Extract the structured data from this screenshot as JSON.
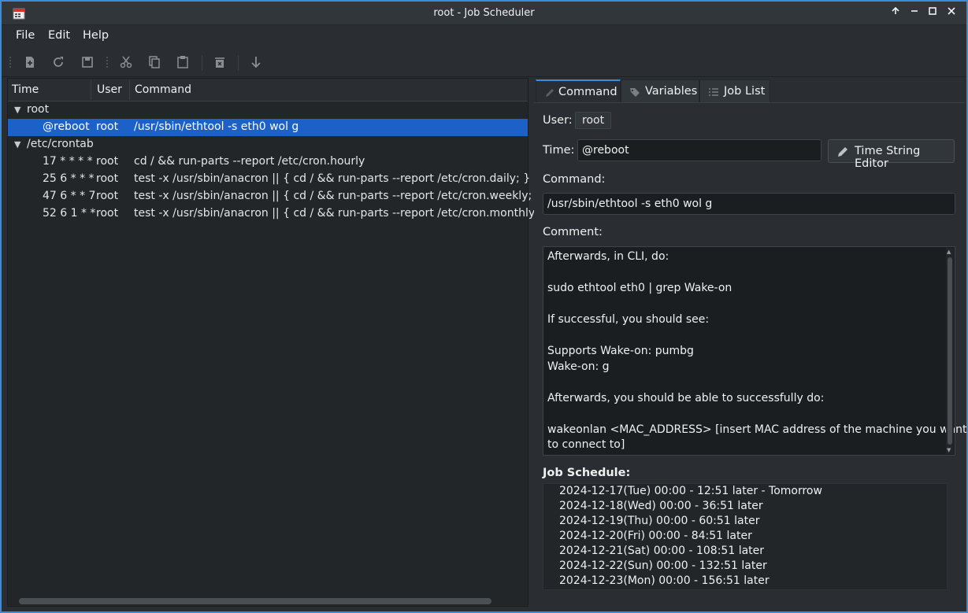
{
  "window": {
    "title": "root - Job Scheduler"
  },
  "menubar": {
    "file": "File",
    "edit": "Edit",
    "help": "Help"
  },
  "toolbar": {
    "icons": [
      "new-job-icon",
      "reload-icon",
      "save-icon",
      "cut-icon",
      "copy-icon",
      "paste-icon",
      "delete-icon",
      "move-down-icon"
    ]
  },
  "tree": {
    "headers": {
      "time": "Time",
      "user": "User",
      "command": "Command"
    },
    "groups": [
      {
        "name": "root",
        "jobs": [
          {
            "time": "@reboot",
            "user": "root",
            "command": "/usr/sbin/ethtool -s eth0 wol g"
          }
        ]
      },
      {
        "name": "/etc/crontab",
        "jobs": [
          {
            "time": "17 * * * *",
            "user": "root",
            "command": "cd / && run-parts --report /etc/cron.hourly"
          },
          {
            "time": "25 6 * * *",
            "user": "root",
            "command": "test -x /usr/sbin/anacron || { cd / && run-parts --report /etc/cron.daily; }"
          },
          {
            "time": "47 6 * * 7",
            "user": "root",
            "command": "test -x /usr/sbin/anacron || { cd / && run-parts --report /etc/cron.weekly; }"
          },
          {
            "time": "52 6 1 * *",
            "user": "root",
            "command": "test -x /usr/sbin/anacron || { cd / && run-parts --report /etc/cron.monthly; }"
          }
        ]
      }
    ]
  },
  "tabs": {
    "command": "Command",
    "variables": "Variables",
    "job_list": "Job List"
  },
  "detail": {
    "user_label": "User:",
    "user_value": "root",
    "time_label": "Time:",
    "time_value": "@reboot",
    "time_editor_button": "Time String Editor",
    "command_label": "Command:",
    "command_value": "/usr/sbin/ethtool -s eth0 wol g",
    "comment_label": "Comment:",
    "comment_lines": [
      "Afterwards, in CLI, do:",
      "",
      "sudo ethtool eth0 | grep Wake-on",
      "",
      "If successful, you should see:",
      "",
      "Supports Wake-on: pumbg",
      "Wake-on: g",
      "",
      "Afterwards, you should be able to successfully do:",
      "",
      "wakeonlan <MAC_ADDRESS> [insert MAC address of the machine you want",
      "to connect to]"
    ],
    "schedule_label": "Job Schedule:",
    "schedule": [
      "2024-12-17(Tue) 00:00 - 12:51 later - Tomorrow",
      "2024-12-18(Wed) 00:00 - 36:51 later",
      "2024-12-19(Thu) 00:00 - 60:51 later",
      "2024-12-20(Fri) 00:00 - 84:51 later",
      "2024-12-21(Sat) 00:00 - 108:51 later",
      "2024-12-22(Sun) 00:00 - 132:51 later",
      "2024-12-23(Mon) 00:00 - 156:51 later"
    ]
  },
  "colors": {
    "accent": "#3b8cd9",
    "selection": "#1c61c7"
  }
}
